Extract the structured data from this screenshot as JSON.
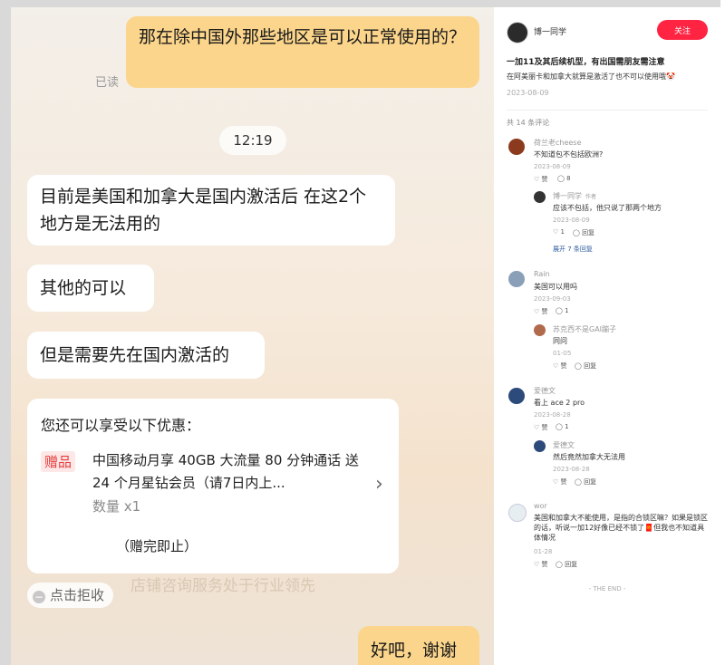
{
  "chat": {
    "messages": [
      {
        "side": "right",
        "text": "那在除中国外那些地区是可以正常使用的？"
      },
      {
        "side": "left",
        "text": "目前是美国和加拿大是国内激活后  在这2个地方是无法用的"
      },
      {
        "side": "left",
        "text": "其他的可以"
      },
      {
        "side": "left",
        "text": "但是需要先在国内激活的"
      },
      {
        "side": "right",
        "text": "好吧，谢谢"
      }
    ],
    "read_status": "已读",
    "timestamp": "12:19",
    "offer": {
      "title": "您还可以享受以下优惠：",
      "badge": "赠品",
      "description": "中国移动月享 40GB 大流量 80 分钟通话 送 24 个月星钻会员（请7日内上...",
      "quantity": "数量 x1",
      "note": "（赠完即止）"
    },
    "reject_label": "点击拒收",
    "watermark": "店铺咨询服务处于行业领先"
  },
  "post": {
    "author": "博一同学",
    "follow_label": "关注",
    "title": "一加11及其后续机型，有出国需朋友需注意",
    "body": "在阿美丽卡和加拿大就算是激活了也不可以使用哦🤡",
    "date": "2023-08-09",
    "comment_count": "共 14 条评论",
    "comments": [
      {
        "name": "荷兰老cheese",
        "text": "不知道包不包括欧洲?",
        "date": "2023-08-09",
        "like": "赞",
        "reply": "8",
        "replies": [
          {
            "name": "博一同学",
            "tag": "作者",
            "text": "应该不包括，他只说了那两个地方",
            "date": "2023-08-09",
            "like": "1",
            "reply": "回复"
          }
        ],
        "expand": "展开 7 条回复"
      },
      {
        "name": "Rain",
        "text": "美国可以用吗",
        "date": "2023-09-03",
        "like": "赞",
        "reply": "1",
        "replies": [
          {
            "name": "苏克西不是GAI蹦子",
            "text": "同问",
            "date": "01-05",
            "like": "赞",
            "reply": "回复"
          }
        ]
      },
      {
        "name": "爱德文",
        "text": "看上 ace 2 pro",
        "date": "2023-08-28",
        "like": "赞",
        "reply": "1",
        "replies": [
          {
            "name": "爱德文",
            "text": "然后竟然加拿大无法用",
            "date": "2023-08-28",
            "like": "赞",
            "reply": "回复"
          }
        ]
      },
      {
        "name": "wor",
        "text": "美国和加拿大不能使用，是指的合锁区嘛？如果是锁区的话，听说一加12好像已经不锁了🧧但我也不知道具体情况",
        "date": "01-28",
        "like": "赞",
        "reply": "回复"
      }
    ],
    "the_end": "- THE END -"
  },
  "colors": {
    "follow": "#ff2442",
    "bubble_right": "#fbd58b",
    "bubble_left": "#ffffff",
    "gift": "#e83b3b",
    "link": "#2d5a9f"
  }
}
